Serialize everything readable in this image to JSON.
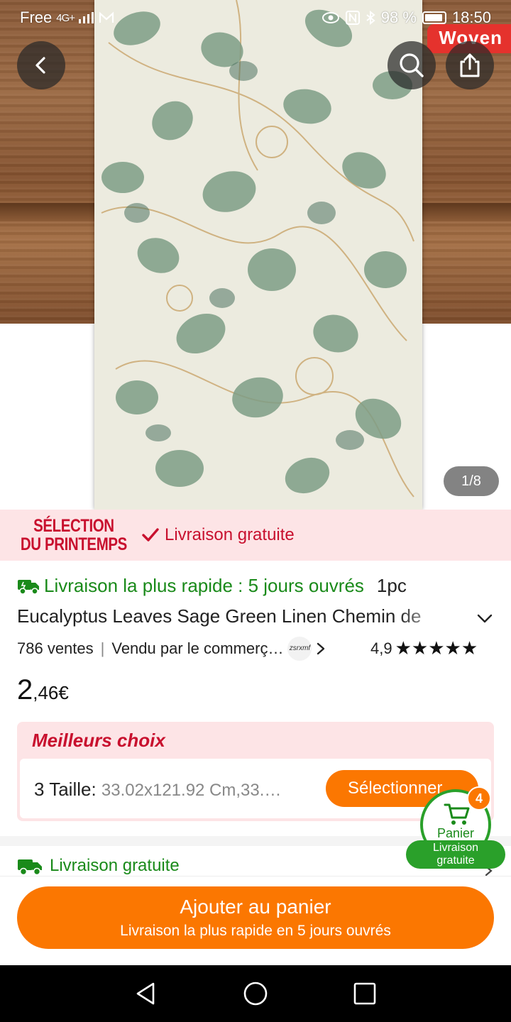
{
  "status_bar": {
    "carrier": "Free",
    "network": "4G+",
    "battery": "98 %",
    "time": "18:50"
  },
  "hero": {
    "badge": "Woven",
    "image_counter": "1/8"
  },
  "icons": {
    "back": "back-arrow-icon",
    "search": "search-icon",
    "share": "share-icon",
    "truck": "truck-icon",
    "cart": "cart-icon"
  },
  "promo": {
    "logo_line1": "SÉLECTION",
    "logo_line2": "DU PRINTEMPS",
    "free_shipping": "Livraison gratuite"
  },
  "product": {
    "fast_delivery": "Livraison la plus rapide : 5 jours ouvrés",
    "quantity": "1pc",
    "title": "Eucalyptus Leaves Sage Green Linen Chemin de",
    "sales": "786 ventes",
    "seller": "Vendu par le commerç…",
    "seller_badge": "zsrxmf",
    "rating": "4,9",
    "stars": "★★★★★",
    "price_int": "2",
    "price_dec": ",46€"
  },
  "best_choice": {
    "title": "Meilleurs choix",
    "size_label": "3 Taille:",
    "size_value": "33.02x121.92 Cm,33.…",
    "select_button": "Sélectionner"
  },
  "shipping": {
    "label": "Livraison gratuite"
  },
  "cart": {
    "label": "Panier",
    "count": "4",
    "shipping_line1": "Livraison",
    "shipping_line2": "gratuite"
  },
  "cta": {
    "main": "Ajouter au panier",
    "sub": "Livraison la plus rapide en 5 jours ouvrés"
  },
  "colors": {
    "accent": "#fb7701",
    "promo_red": "#c8102e",
    "green": "#1a8a1a",
    "promo_bg": "#fde4e6"
  }
}
